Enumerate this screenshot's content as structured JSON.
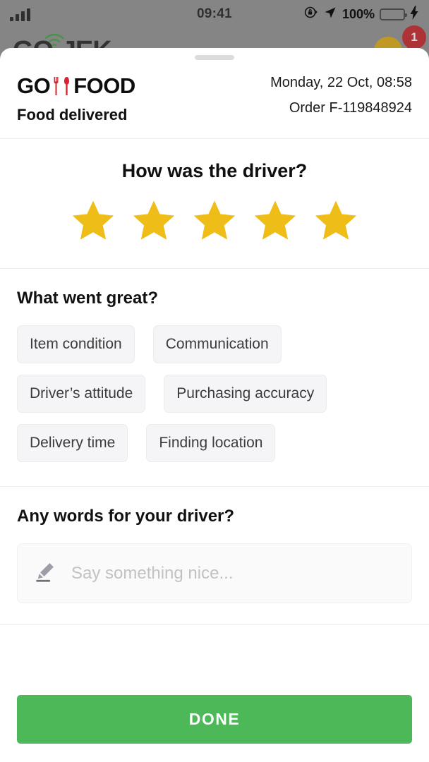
{
  "status_bar": {
    "signal_icon": "signal-bars-icon",
    "time": "09:41",
    "rotation_lock_icon": "rotation-lock-icon",
    "location_icon": "location-arrow-icon",
    "battery_percent": "100%",
    "battery_icon": "battery-icon",
    "charging_icon": "lightning-bolt-icon",
    "battery_color": "#4cd964"
  },
  "background_app": {
    "logo_text": "GO-JEK",
    "wifi_icon": "wifi-signal-icon",
    "wifi_color": "#3a9b3a",
    "avatar_icon": "avatar-icon",
    "avatar_color": "#e0a800",
    "notification_badge": "1",
    "badge_color": "#c4161c"
  },
  "sheet": {
    "grabber_icon": "drag-handle-icon",
    "header": {
      "logo_prefix": "GO",
      "logo_suffix": "FOOD",
      "utensils_icon": "fork-and-spoon-icon",
      "utensils_color": "#d9232e",
      "status": "Food delivered",
      "date": "Monday, 22 Oct, 08:58",
      "order": "Order F-119848924"
    },
    "rating": {
      "question": "How was the driver?",
      "star_icon": "star-icon",
      "star_color": "#efbd17",
      "total_stars": 5,
      "selected_stars": 5
    },
    "tags": {
      "title": "What went great?",
      "items": [
        "Item condition",
        "Communication",
        "Driver’s attitude",
        "Purchasing accuracy",
        "Delivery time",
        "Finding location"
      ]
    },
    "comment": {
      "title": "Any words for your driver?",
      "pencil_icon": "pencil-edit-icon",
      "placeholder": "Say something nice...",
      "value": ""
    },
    "footer": {
      "done_label": "DONE",
      "done_color": "#4cb857"
    }
  }
}
